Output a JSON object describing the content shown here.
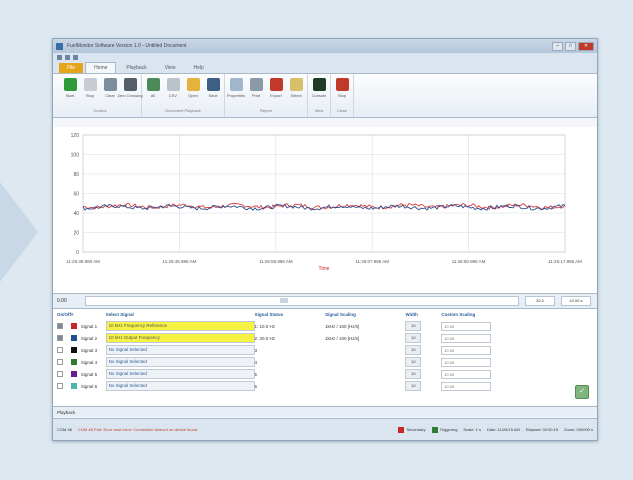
{
  "window": {
    "title": "FuelMonitor Software Version 1.0 - Untitled Document",
    "minimize": "–",
    "maximize": "□",
    "close": "✕"
  },
  "tabs": [
    {
      "label": "File"
    },
    {
      "label": "Home"
    },
    {
      "label": "Playback"
    },
    {
      "label": "View"
    },
    {
      "label": "Help"
    }
  ],
  "ribbon": {
    "groups": [
      {
        "name": "Control",
        "buttons": [
          {
            "label": "Start",
            "icon": "play-icon",
            "color": "#2f9a3a"
          },
          {
            "label": "Stop",
            "icon": "stop-icon",
            "color": "#c7ccd3"
          },
          {
            "label": "Clear",
            "icon": "brush-icon",
            "color": "#7f8c99"
          },
          {
            "label": "Zero Crossing",
            "icon": "phone-icon",
            "color": "#555f69"
          }
        ]
      },
      {
        "name": "Document Playback",
        "buttons": [
          {
            "label": "All",
            "icon": "record-icon",
            "color": "#4d8a5a"
          },
          {
            "label": "CSV",
            "icon": "doc-icon",
            "color": "#b9c3ce"
          },
          {
            "label": "Open",
            "icon": "folder-icon",
            "color": "#e5b33d"
          },
          {
            "label": "Save",
            "icon": "save-icon",
            "color": "#3e5f84"
          }
        ]
      },
      {
        "name": "Report",
        "buttons": [
          {
            "label": "Properties",
            "icon": "magnifier-icon",
            "color": "#9fb6cc"
          },
          {
            "label": "Print",
            "icon": "print-icon",
            "color": "#8b98a6"
          },
          {
            "label": "Export",
            "icon": "pin-icon",
            "color": "#c0392b"
          },
          {
            "label": "Select",
            "icon": "select-icon",
            "color": "#d8c06b"
          }
        ]
      },
      {
        "name": "View",
        "buttons": [
          {
            "label": "Console",
            "icon": "console-icon",
            "color": "#1f3a26"
          }
        ]
      },
      {
        "name": "Close",
        "buttons": [
          {
            "label": "Stop",
            "icon": "power-icon",
            "color": "#c0392b"
          }
        ]
      }
    ]
  },
  "chart_data": {
    "type": "line",
    "yticks": [
      120,
      100,
      80,
      60,
      40,
      20,
      0
    ],
    "ylim": [
      0,
      120
    ],
    "xticks": [
      "11:26:35.986 AM",
      "11:26:45.986 AM",
      "11:26:55.986 AM",
      "11:26:07.986 AM",
      "11:26:50.986 AM",
      "11:26:17.986 AM"
    ],
    "xlabel": "Time",
    "series": [
      {
        "color": "#d93b3b",
        "level": 47
      },
      {
        "color": "#2a4d8f",
        "level": 46
      }
    ],
    "grid": true
  },
  "toolbar2": {
    "zoom": "0.00",
    "value1": "30.0",
    "value2": "10.00 s"
  },
  "table": {
    "headers": [
      "On/Off",
      "#",
      "",
      "Select Signal",
      "Signal Status",
      "Signal Scaling",
      "Width",
      "Custom Scaling"
    ],
    "rows": [
      {
        "on": true,
        "color": "#c62828",
        "name": "Signal 1",
        "signal": "10 kHz Frequency Reference",
        "status": "1: 10.0 Hz",
        "scaling": "1kHz / 100 [Hz/s]",
        "width": "10",
        "custom": "10.00",
        "highlight": true
      },
      {
        "on": true,
        "color": "#1f4f8f",
        "name": "Signal 2",
        "signal": "10 kHz Output Frequency",
        "status": "2: 20.0 Hz",
        "scaling": "1kHz / 100 [Hz/s]",
        "width": "10",
        "custom": "10.00",
        "highlight": true
      },
      {
        "on": false,
        "color": "#111111",
        "name": "Signal 3",
        "signal": "No Signal Selected",
        "status": "3",
        "scaling": "",
        "width": "10",
        "custom": "10.00",
        "highlight": false
      },
      {
        "on": false,
        "color": "#2e7d32",
        "name": "Signal 4",
        "signal": "No Signal Selected",
        "status": "4",
        "scaling": "",
        "width": "10",
        "custom": "10.00",
        "highlight": false
      },
      {
        "on": false,
        "color": "#6a1b9a",
        "name": "Signal 5",
        "signal": "No Signal Selected",
        "status": "5",
        "scaling": "",
        "width": "10",
        "custom": "10.00",
        "highlight": false
      },
      {
        "on": false,
        "color": "#4db6ac",
        "name": "Signal 6",
        "signal": "No Signal Selected",
        "status": "6",
        "scaling": "",
        "width": "10",
        "custom": "10.00",
        "highlight": false
      }
    ],
    "ok": "✓"
  },
  "playback": {
    "label": "Playback"
  },
  "status": {
    "left": "COM 48",
    "error": "COM 48 Port: Error read error: Connection timeout no device found",
    "legend1": "Secondary",
    "legend2": "Triggering",
    "scale": "Scale: 1 s",
    "date": "Date: 11/26/15 AM",
    "elapsed": "Elapsed: 00:00:15",
    "window": "Zoom: 000000 s"
  }
}
